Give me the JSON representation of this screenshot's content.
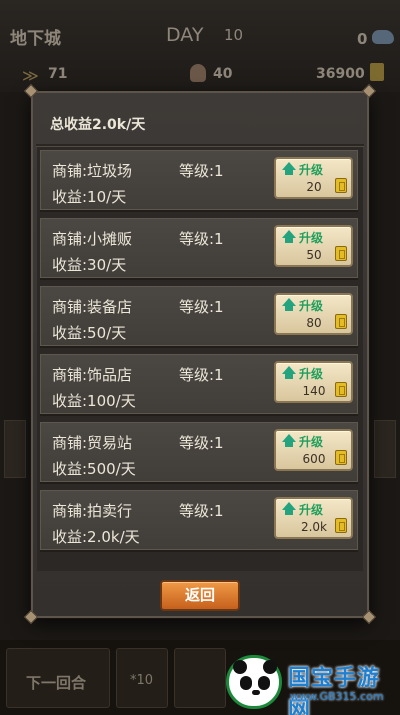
{
  "hud": {
    "location": "地下城",
    "day_label": "DAY",
    "day_value": "10",
    "gems": "0",
    "rank": "71",
    "population": "40",
    "gold": "36900",
    "gem_icon": "gem-icon",
    "rank_icon": "rank-chevron-icon",
    "population_icon": "population-icon",
    "gold_icon": "gold-coin-icon"
  },
  "bottom_bar": {
    "next_round_label": "下一回合",
    "multiplier_label": "*10"
  },
  "dialog": {
    "title": "总收益2.0k/天",
    "upgrade_label": "升级",
    "back_label": "返回",
    "shops": [
      {
        "name": "商铺:垃圾场",
        "level": "等级:1",
        "income": "收益:10/天",
        "upgrade_cost": "20"
      },
      {
        "name": "商铺:小摊贩",
        "level": "等级:1",
        "income": "收益:30/天",
        "upgrade_cost": "50"
      },
      {
        "name": "商铺:装备店",
        "level": "等级:1",
        "income": "收益:50/天",
        "upgrade_cost": "80"
      },
      {
        "name": "商铺:饰品店",
        "level": "等级:1",
        "income": "收益:100/天",
        "upgrade_cost": "140"
      },
      {
        "name": "商铺:贸易站",
        "level": "等级:1",
        "income": "收益:500/天",
        "upgrade_cost": "600"
      },
      {
        "name": "商铺:拍卖行",
        "level": "等级:1",
        "income": "收益:2.0k/天",
        "upgrade_cost": "2.0k"
      }
    ]
  },
  "watermark": {
    "brand": "国宝手游网",
    "url": "www.GB315.com"
  },
  "colors": {
    "upgrade_green": "#1f9e5c",
    "back_button_orange": "#d9772c",
    "panel_bg": "#3a3633",
    "coin_gold": "#e3bc26"
  }
}
